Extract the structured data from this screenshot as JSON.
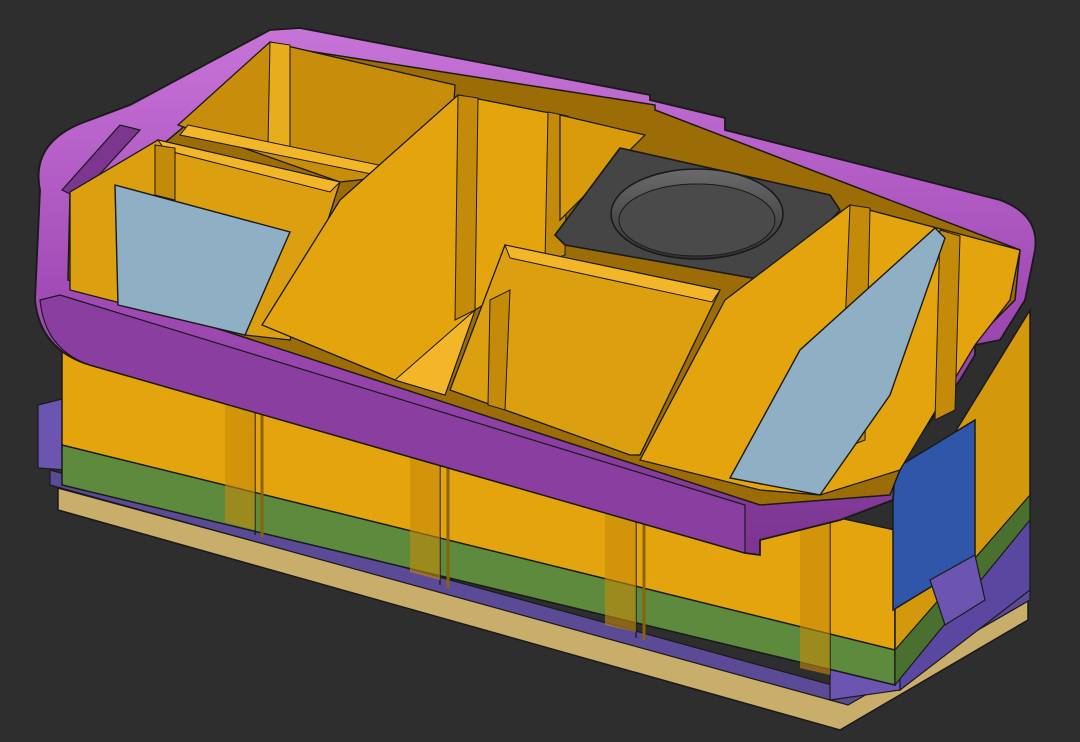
{
  "scene": {
    "background": "#2e2e2e",
    "colors": {
      "rim": "#a24bb6",
      "rim_light": "#c06ad2",
      "rim_dark": "#7d3690",
      "bin": "#e3a40e",
      "bin_dark": "#b07d0a",
      "bin_light": "#f2b628",
      "divider": "#8fb0c4",
      "cup_holder": "#454545",
      "cup_ring": "#5e5e5e",
      "lower_band": "#5d8a3d",
      "lower_band_dark": "#4a7030",
      "base": "#c9ad6a",
      "base_plate": "#5b4a96",
      "latch": "#2f56a8",
      "edge": "#1a1a1a"
    }
  }
}
